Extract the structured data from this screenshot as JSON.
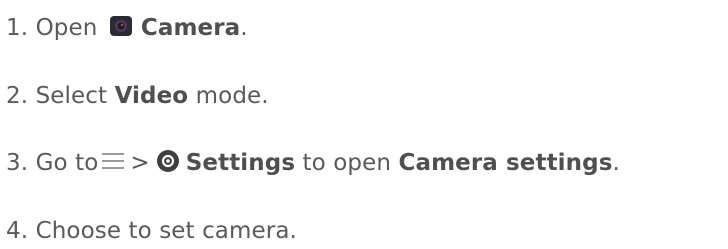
{
  "steps": [
    {
      "number": "1.",
      "pre": "Open",
      "icon": "camera-app-icon",
      "bold": "Camera",
      "post": "."
    },
    {
      "number": "2.",
      "pre": "Select",
      "bold": "Video",
      "post": "mode."
    },
    {
      "number": "3.",
      "pre": "Go to",
      "menu_icon": "menu-icon",
      "separator": ">",
      "gear_icon": "settings-gear-icon",
      "bold": "Settings",
      "middle": "to open",
      "bold2": "Camera settings",
      "post": "."
    },
    {
      "number": "4.",
      "text": "Choose to set camera."
    }
  ],
  "colors": {
    "text": "#5a5a5a",
    "camera_icon_bg": "#2b2b36",
    "camera_icon_accent": "#c33a52",
    "gear_icon_bg": "#3f3f3f",
    "menu_lines": "#9a9a9a"
  }
}
